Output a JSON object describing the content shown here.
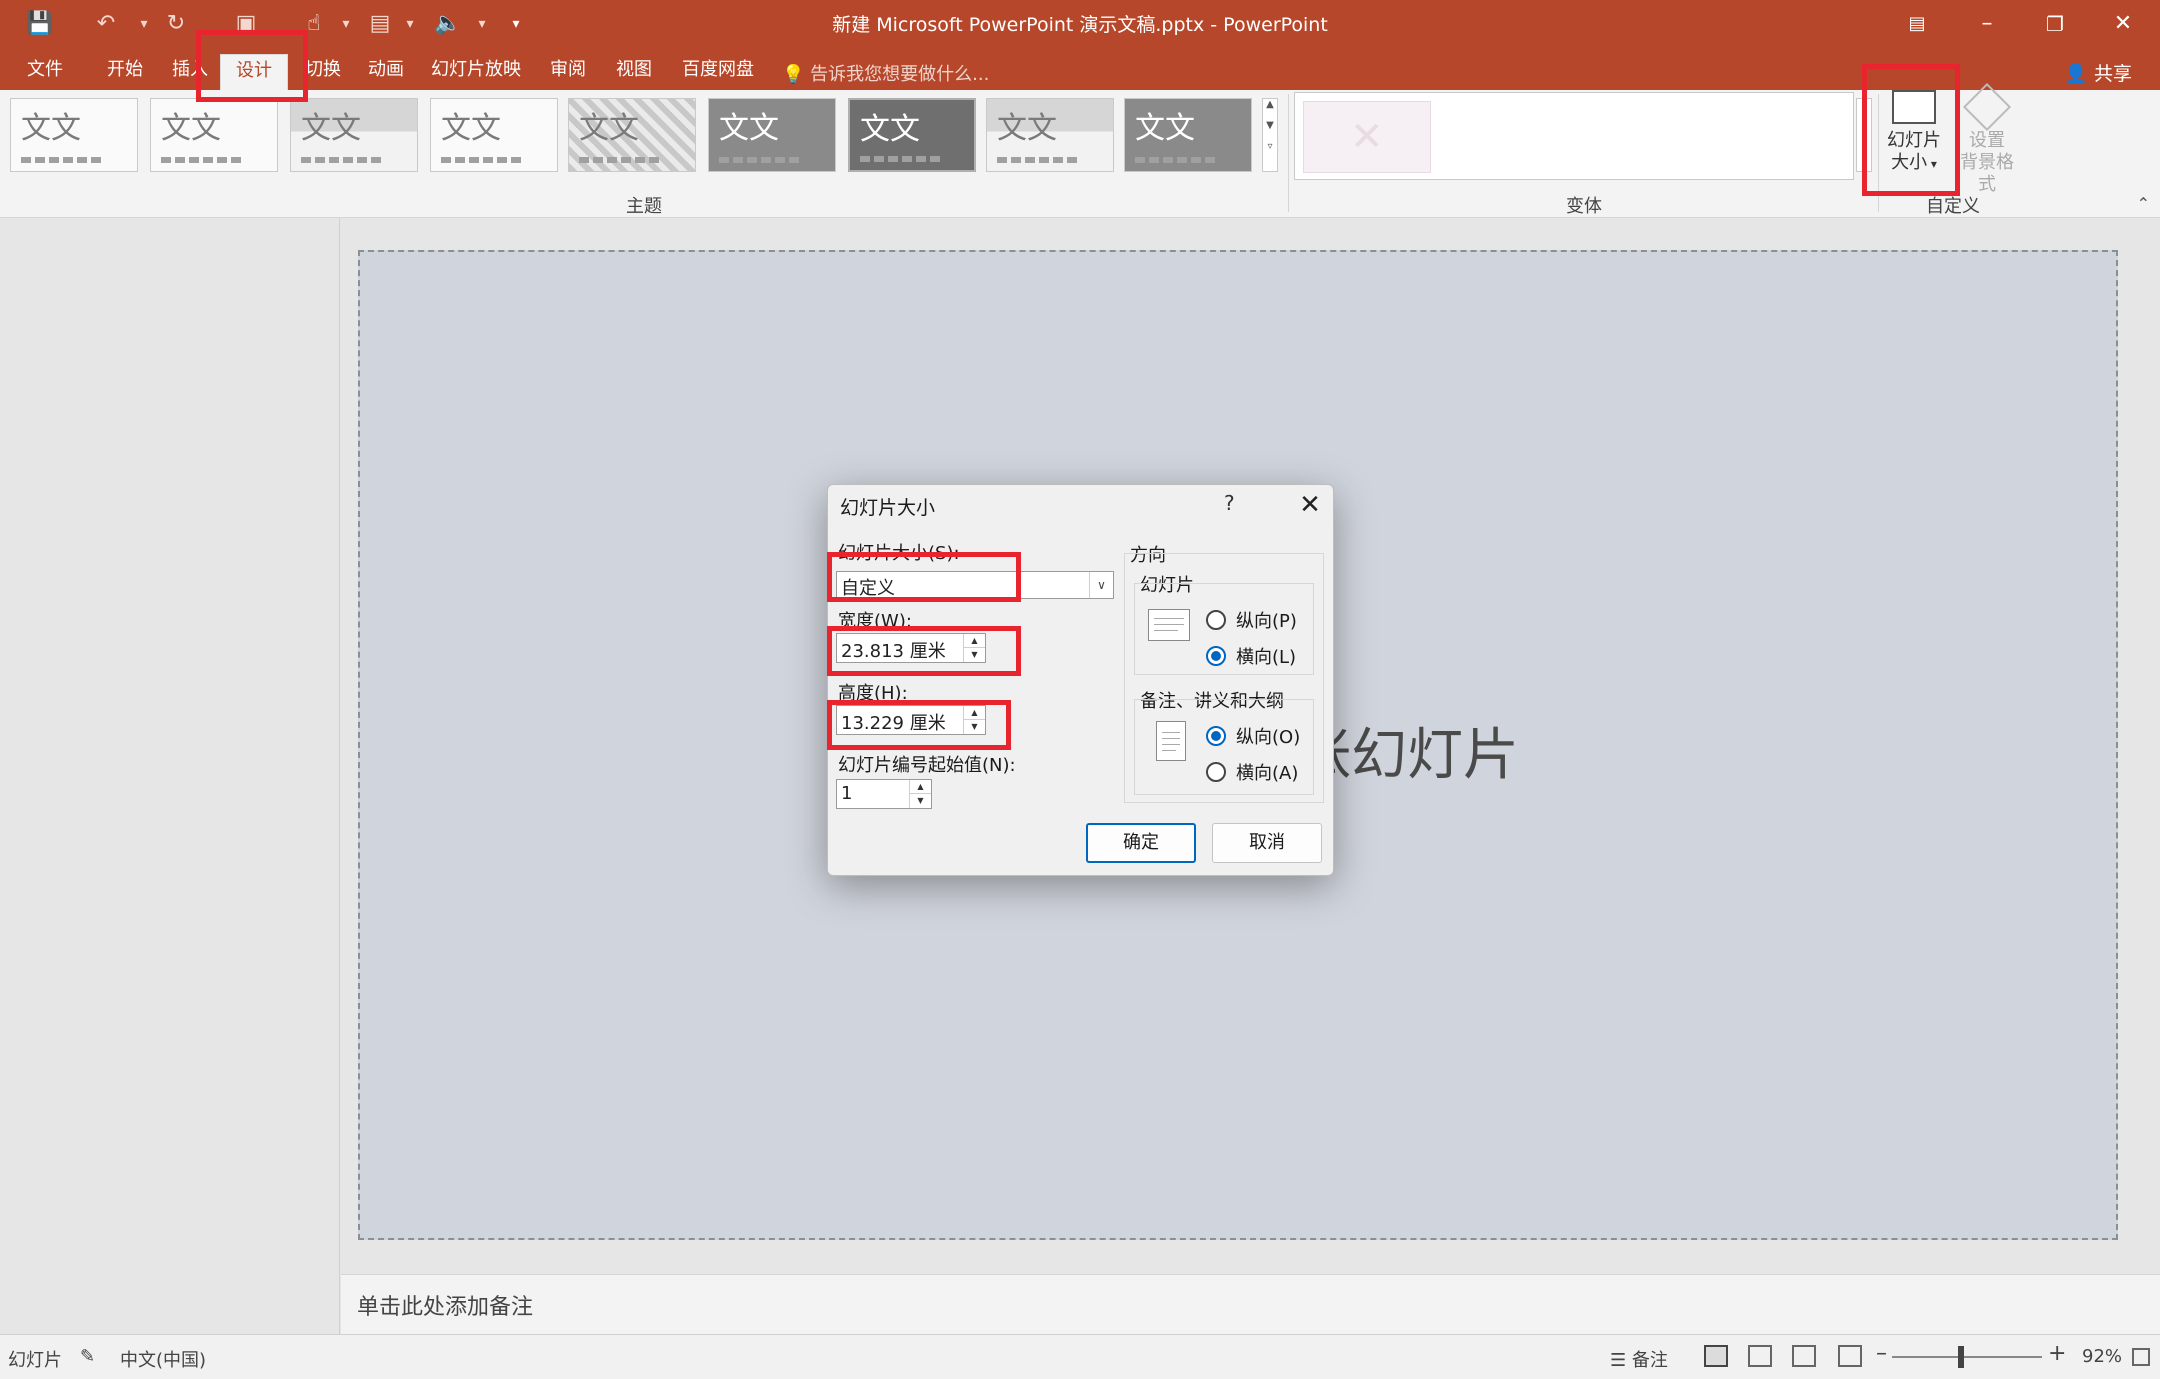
{
  "window": {
    "title": "新建 Microsoft PowerPoint 演示文稿.pptx - PowerPoint"
  },
  "tabs": [
    {
      "label": "文件"
    },
    {
      "label": "开始"
    },
    {
      "label": "插入"
    },
    {
      "label": "设计"
    },
    {
      "label": "切换"
    },
    {
      "label": "动画"
    },
    {
      "label": "幻灯片放映"
    },
    {
      "label": "审阅"
    },
    {
      "label": "视图"
    },
    {
      "label": "百度网盘"
    }
  ],
  "active_tab": "设计",
  "tell_me": "告诉我您想要做什么...",
  "share": "共享",
  "ribbon": {
    "theme_thumb_text": "文文",
    "themes_label": "主题",
    "variants_label": "变体",
    "customize_label": "自定义",
    "slide_size_line1": "幻灯片",
    "slide_size_line2": "大小",
    "bg_format_line1": "设置",
    "bg_format_line2": "背景格式"
  },
  "slide": {
    "visible_text": "张幻灯片"
  },
  "notes_placeholder": "单击此处添加备注",
  "statusbar": {
    "slide_label": "幻灯片",
    "language": "中文(中国)",
    "notes": "备注",
    "zoom": "92%"
  },
  "dialog": {
    "title": "幻灯片大小",
    "help": "?",
    "slide_size_label": "幻灯片大小(S):",
    "slide_size_value": "自定义",
    "width_label": "宽度(W):",
    "width_value": "23.813 厘米",
    "height_label": "高度(H):",
    "height_value": "13.229 厘米",
    "start_number_label": "幻灯片编号起始值(N):",
    "start_number_value": "1",
    "orientation_label": "方向",
    "slides_group": "幻灯片",
    "slides_portrait": "纵向(P)",
    "slides_landscape": "横向(L)",
    "notes_group": "备注、讲义和大纲",
    "notes_portrait": "纵向(O)",
    "notes_landscape": "横向(A)",
    "ok": "确定",
    "cancel": "取消"
  }
}
